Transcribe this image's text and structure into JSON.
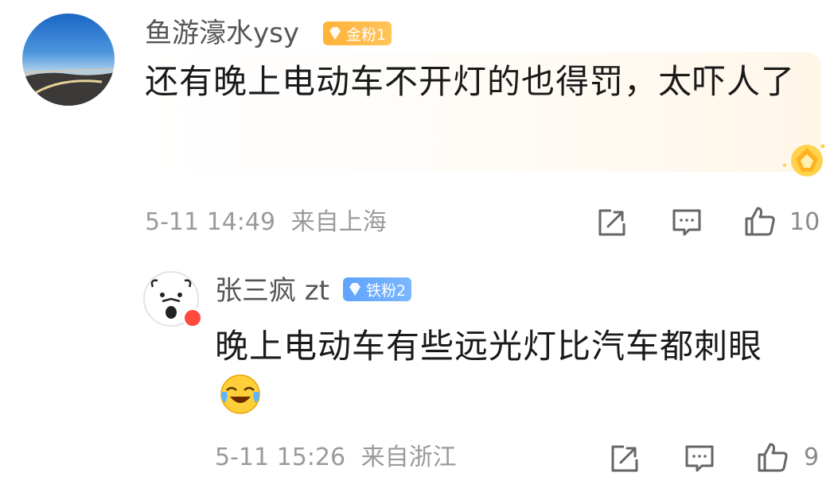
{
  "comments": [
    {
      "username": "鱼游濠水ysy",
      "badge": "金粉1",
      "text": "还有晚上电动车不开灯的也得罚，太吓人了",
      "time": "5-11 14:49",
      "location": "来自上海",
      "likes": "10",
      "badge_color": "#ffb238",
      "icons": [
        "share-icon",
        "comment-icon",
        "like-icon"
      ]
    },
    {
      "username": "张三疯 zt",
      "badge": "铁粉2",
      "text": "晚上电动车有些远光灯比汽车都刺眼",
      "time": "5-11 15:26",
      "location": "来自浙江",
      "likes": "9",
      "badge_color": "#5fa3ff",
      "icons": [
        "share-icon",
        "comment-icon",
        "like-icon"
      ]
    }
  ]
}
